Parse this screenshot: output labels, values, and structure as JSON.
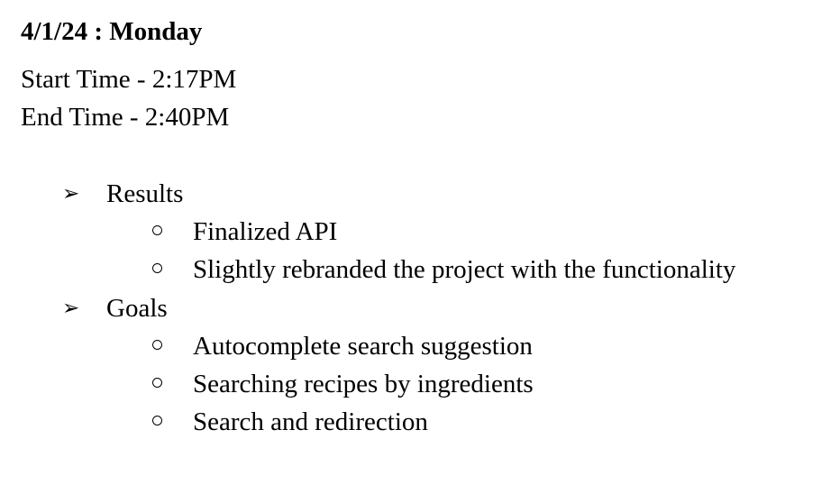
{
  "header": {
    "date_title": "4/1/24 : Monday"
  },
  "times": {
    "start": "Start Time - 2:17PM",
    "end": "End Time - 2:40PM"
  },
  "sections": [
    {
      "label": "Results",
      "bullet_icon": "arrowhead-bullet-icon",
      "items": [
        "Finalized API",
        "Slightly rebranded the project with the functionality"
      ]
    },
    {
      "label": "Goals",
      "bullet_icon": "arrowhead-bullet-icon",
      "items": [
        "Autocomplete search suggestion",
        "Searching recipes by ingredients",
        "Search and redirection"
      ]
    }
  ]
}
